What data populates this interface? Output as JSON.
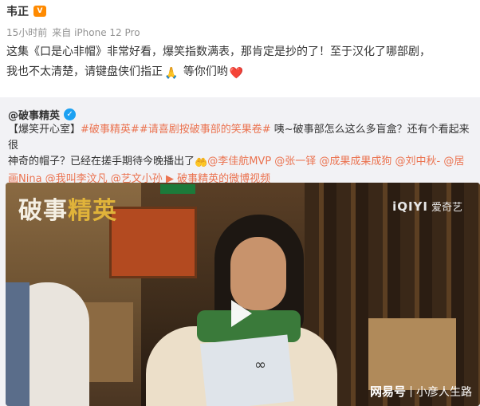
{
  "post": {
    "username": "韦正",
    "vip_badge": "V",
    "time": "15小时前",
    "source": "来自 iPhone 12 Pro",
    "text_line1": "这集《口是心非帽》非常好看，爆笑指数满表，那肯定是抄的了！至于汉化了哪部剧，",
    "text_line2_a": "我也不太清楚，请键盘侠们指正",
    "text_line2_b": "等你们哟",
    "emoji_pray": "🙏",
    "emoji_heart": "❤️"
  },
  "retweet": {
    "author": "@破事精英",
    "verified_icon": "✓",
    "prefix": "【爆笑开心室】",
    "tag1": "#破事精英#",
    "tag2": "#请喜剧按破事部的笑果卷#",
    "text_a": "咦~破事部怎么这么多盲盒？还有个看起来很",
    "text_b": "神奇的帽子？已经在搓手期待今晚播出了",
    "emoji_hands": "🤲",
    "mentions_1": "@李佳航MVP @张一铎 @成果成果成狗 @刘中秋- @居",
    "mentions_2": "画Nina @我叫李汶凡 @艺文小孙",
    "video_link": "破事精英的微博视频",
    "video_icon": "▶"
  },
  "video": {
    "logo_a": "破事",
    "logo_b": "精英",
    "iqiyi_brand": "iQIYI",
    "iqiyi_cn": "爱奇艺",
    "card_symbol": "∞",
    "watermark_a": "网易号",
    "watermark_b": "小彦人生路"
  }
}
